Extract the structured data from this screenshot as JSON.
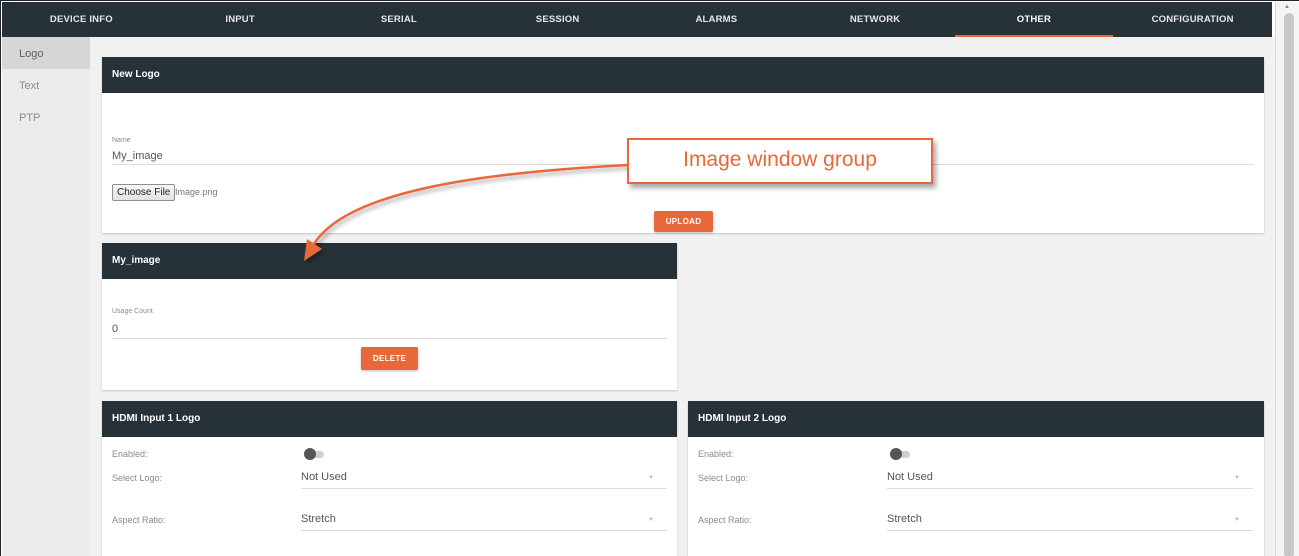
{
  "nav": {
    "tabs": [
      "DEVICE INFO",
      "INPUT",
      "SERIAL",
      "SESSION",
      "ALARMS",
      "NETWORK",
      "OTHER",
      "CONFIGURATION"
    ],
    "active": "OTHER",
    "accent_color": "#e9683a"
  },
  "sidebar": {
    "items": [
      {
        "label": "Logo"
      },
      {
        "label": "Text"
      },
      {
        "label": "PTP"
      }
    ]
  },
  "new_logo": {
    "title": "New Logo",
    "name_label": "Name",
    "name_value": "My_image",
    "choose_file_label": "Choose File",
    "file_name": "Image.png",
    "upload_label": "UPLOAD"
  },
  "image_card": {
    "title": "My_image",
    "usage_label": "Usage Count",
    "usage_value": "0",
    "delete_label": "DELETE"
  },
  "hdmi1": {
    "title": "HDMI Input 1 Logo",
    "enabled_label": "Enabled:",
    "enabled": false,
    "select_logo_label": "Select Logo:",
    "select_logo_value": "Not Used",
    "aspect_label": "Aspect Ratio:",
    "aspect_value": "Stretch"
  },
  "hdmi2": {
    "title": "HDMI Input 2 Logo",
    "enabled_label": "Enabled:",
    "enabled": false,
    "select_logo_label": "Select Logo:",
    "select_logo_value": "Not Used",
    "aspect_label": "Aspect Ratio:",
    "aspect_value": "Stretch"
  },
  "annotation": {
    "text": "Image window group",
    "color": "#e9683a"
  }
}
